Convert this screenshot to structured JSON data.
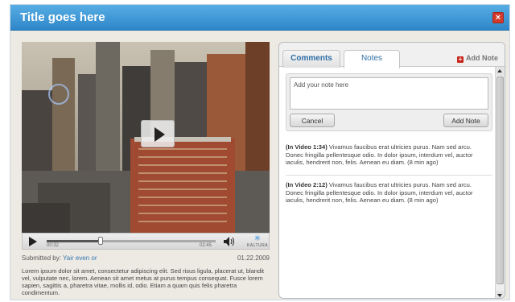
{
  "window": {
    "title": "Title goes here"
  },
  "player": {
    "elapsed": "00:32",
    "total": "02:45",
    "progress": 0.32,
    "brand": "KALTURA"
  },
  "meta": {
    "submitted_label": "Submitted by:",
    "author": "Yair even or",
    "date": "01.22.2009"
  },
  "description": "Lorem ipsum dolor sit amet, consectetur adipiscing elit. Sed risus ligula, placerat ut, blandit vel, vulputate nec, lorem. Aenean sit amet metus at purus tempus consequat. Fusce lorem sapien, sagittis a, pharetra vitae, mollis id, odio. Etiam a quam quis felis pharetra condimentum.",
  "tabs": {
    "comments": "Comments",
    "notes": "Notes",
    "add_note_link": "Add Note"
  },
  "note_form": {
    "placeholder": "Add your note here",
    "cancel": "Cancel",
    "add": "Add Note"
  },
  "notes": [
    {
      "timestamp": "(In Video 1:34)",
      "text": "Vivamus faucibus erat ultricies purus. Nam sed arcu. Donec fringilla pellentesque odio. In dolor ipsum, interdum vel, auctor iaculis, hendrerit non, felis. Aenean eu diam. (8 min ago)"
    },
    {
      "timestamp": "(In Video 2:12)",
      "text": "Vivamus faucibus erat ultricies purus. Nam sed arcu. Donec fringilla pellentesque odio. In dolor ipsum, interdum vel, auctor iaculis, hendrerit non, felis. Aenean eu diam. (8 min ago)"
    }
  ],
  "colors": {
    "titlebar": "#3f9ad8",
    "link": "#3778b0",
    "close": "#d23a2b"
  }
}
